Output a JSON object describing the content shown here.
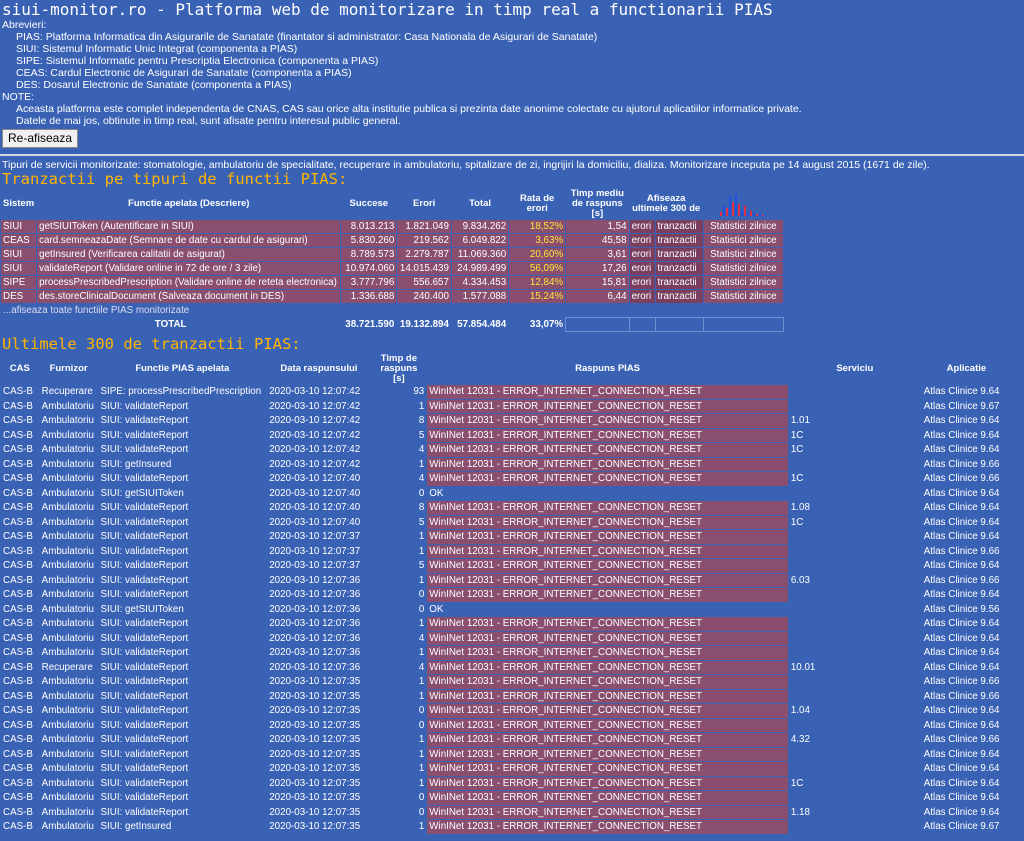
{
  "header": {
    "title": "siui-monitor.ro - Platforma web de monitorizare in timp real a functionarii PIAS",
    "abbr_label": "Abrevieri:",
    "abbr": [
      "PIAS: Platforma Informatica din Asigurarile de Sanatate (finantator si administrator: Casa Nationala de Asigurari de Sanatate)",
      "SIUI: Sistemul Informatic Unic Integrat (componenta a PIAS)",
      "SIPE: Sistemul Informatic pentru Prescriptia Electronica (componenta a PIAS)",
      "CEAS: Cardul Electronic de Asigurari de Sanatate (componenta a PIAS)",
      "DES: Dosarul Electronic de Sanatate (componenta a PIAS)"
    ],
    "note_label": "NOTE:",
    "notes": [
      "Aceasta platforma este complet independenta de CNAS, CAS sau orice alta institutie publica si prezinta date anonime colectate cu ajutorul aplicatiilor informatice private.",
      "Datele de mai jos, obtinute in timp real, sunt afisate pentru interesul public general."
    ],
    "refresh_button": "Re-afiseaza"
  },
  "intro": "Tipuri de servicii monitorizate: stomatologie, ambulatoriu de specialitate, recuperare in ambulatoriu, spitalizare de zi, ingrijiri la domiciliu, dializa. Monitorizare inceputa pe 14 august 2015 (1671 de zile).",
  "section1": {
    "title": "Tranzactii pe tipuri de functii PIAS:",
    "headers": [
      "Sistem",
      "Functie apelata (Descriere)",
      "Succese",
      "Erori",
      "Total",
      "Rata de erori",
      "Timp mediu de raspuns [s]",
      "Afiseaza ultimele 300 de"
    ],
    "rows": [
      {
        "sys": "SIUI",
        "fn": "getSIUIToken (Autentificare in SIUI)",
        "ok": "8.013.213",
        "err": "1.821.049",
        "tot": "9.834.262",
        "rate": "18,52%",
        "time": "1,54"
      },
      {
        "sys": "CEAS",
        "fn": "card.semneazaDate (Semnare de date cu cardul de asigurari)",
        "ok": "5.830.260",
        "err": "219.562",
        "tot": "6.049.822",
        "rate": "3,63%",
        "time": "45,58"
      },
      {
        "sys": "SIUI",
        "fn": "getInsured (Verificarea calitatii de asigurat)",
        "ok": "8.789.573",
        "err": "2.279.787",
        "tot": "11.069.360",
        "rate": "20,60%",
        "time": "3,61"
      },
      {
        "sys": "SIUI",
        "fn": "validateReport (Validare online in 72 de ore / 3 zile)",
        "ok": "10.974.060",
        "err": "14.015.439",
        "tot": "24.989.499",
        "rate": "56,09%",
        "time": "17,26"
      },
      {
        "sys": "SIPE",
        "fn": "processPrescribedPrescription (Validare online de reteta electronica)",
        "ok": "3.777.796",
        "err": "556.657",
        "tot": "4.334.453",
        "rate": "12,84%",
        "time": "15,81"
      },
      {
        "sys": "DES",
        "fn": "des.storeClinicalDocument (Salveaza document in DES)",
        "ok": "1.336.688",
        "err": "240.400",
        "tot": "1.577.088",
        "rate": "15,24%",
        "time": "6,44"
      }
    ],
    "link_erori": "erori",
    "link_tranzactii": "tranzactii",
    "link_stats": "Statistici zilnice",
    "more_link": "...afiseaza toate functiile PIAS monitorizate",
    "total": {
      "label": "TOTAL",
      "ok": "38.721.590",
      "err": "19.132.894",
      "tot": "57.854.484",
      "rate": "33,07%"
    }
  },
  "section2": {
    "title": "Ultimele 300 de tranzactii PIAS:",
    "headers": [
      "CAS",
      "Furnizor",
      "Functie PIAS apelata",
      "Data raspunsului",
      "Timp de raspuns [s]",
      "Raspuns PIAS",
      "Serviciu",
      "Aplicatie"
    ],
    "rows": [
      [
        "CAS-B",
        "Recuperare",
        "SIPE: processPrescribedPrescription",
        "2020-03-10 12:07:42",
        "93",
        "WinINet 12031 - ERROR_INTERNET_CONNECTION_RESET",
        "",
        "Atlas Clinice 9.64"
      ],
      [
        "CAS-B",
        "Ambulatoriu",
        "SIUI: validateReport",
        "2020-03-10 12:07:42",
        "1",
        "WinINet 12031 - ERROR_INTERNET_CONNECTION_RESET",
        "",
        "Atlas Clinice 9.67"
      ],
      [
        "CAS-B",
        "Ambulatoriu",
        "SIUI: validateReport",
        "2020-03-10 12:07:42",
        "8",
        "WinINet 12031 - ERROR_INTERNET_CONNECTION_RESET",
        "1.01",
        "Atlas Clinice 9.64"
      ],
      [
        "CAS-B",
        "Ambulatoriu",
        "SIUI: validateReport",
        "2020-03-10 12:07:42",
        "5",
        "WinINet 12031 - ERROR_INTERNET_CONNECTION_RESET",
        "1C",
        "Atlas Clinice 9.64"
      ],
      [
        "CAS-B",
        "Ambulatoriu",
        "SIUI: validateReport",
        "2020-03-10 12:07:42",
        "4",
        "WinINet 12031 - ERROR_INTERNET_CONNECTION_RESET",
        "1C",
        "Atlas Clinice 9.64"
      ],
      [
        "CAS-B",
        "Ambulatoriu",
        "SIUI: getInsured",
        "2020-03-10 12:07:42",
        "1",
        "WinINet 12031 - ERROR_INTERNET_CONNECTION_RESET",
        "",
        "Atlas Clinice 9.66"
      ],
      [
        "CAS-B",
        "Ambulatoriu",
        "SIUI: validateReport",
        "2020-03-10 12:07:40",
        "4",
        "WinINet 12031 - ERROR_INTERNET_CONNECTION_RESET",
        "1C",
        "Atlas Clinice 9.66"
      ],
      [
        "CAS-B",
        "Ambulatoriu",
        "SIUI: getSIUIToken",
        "2020-03-10 12:07:40",
        "0",
        "OK",
        "",
        "Atlas Clinice 9.64"
      ],
      [
        "CAS-B",
        "Ambulatoriu",
        "SIUI: validateReport",
        "2020-03-10 12:07:40",
        "8",
        "WinINet 12031 - ERROR_INTERNET_CONNECTION_RESET",
        "1.08",
        "Atlas Clinice 9.64"
      ],
      [
        "CAS-B",
        "Ambulatoriu",
        "SIUI: validateReport",
        "2020-03-10 12:07:40",
        "5",
        "WinINet 12031 - ERROR_INTERNET_CONNECTION_RESET",
        "1C",
        "Atlas Clinice 9.64"
      ],
      [
        "CAS-B",
        "Ambulatoriu",
        "SIUI: validateReport",
        "2020-03-10 12:07:37",
        "1",
        "WinINet 12031 - ERROR_INTERNET_CONNECTION_RESET",
        "",
        "Atlas Clinice 9.64"
      ],
      [
        "CAS-B",
        "Ambulatoriu",
        "SIUI: validateReport",
        "2020-03-10 12:07:37",
        "1",
        "WinINet 12031 - ERROR_INTERNET_CONNECTION_RESET",
        "",
        "Atlas Clinice 9.66"
      ],
      [
        "CAS-B",
        "Ambulatoriu",
        "SIUI: validateReport",
        "2020-03-10 12:07:37",
        "5",
        "WinINet 12031 - ERROR_INTERNET_CONNECTION_RESET",
        "",
        "Atlas Clinice 9.64"
      ],
      [
        "CAS-B",
        "Ambulatoriu",
        "SIUI: validateReport",
        "2020-03-10 12:07:36",
        "1",
        "WinINet 12031 - ERROR_INTERNET_CONNECTION_RESET",
        "6.03",
        "Atlas Clinice 9.66"
      ],
      [
        "CAS-B",
        "Ambulatoriu",
        "SIUI: validateReport",
        "2020-03-10 12:07:36",
        "0",
        "WinINet 12031 - ERROR_INTERNET_CONNECTION_RESET",
        "",
        "Atlas Clinice 9.64"
      ],
      [
        "CAS-B",
        "Ambulatoriu",
        "SIUI: getSIUIToken",
        "2020-03-10 12:07:36",
        "0",
        "OK",
        "",
        "Atlas Clinice 9.56"
      ],
      [
        "CAS-B",
        "Ambulatoriu",
        "SIUI: validateReport",
        "2020-03-10 12:07:36",
        "1",
        "WinINet 12031 - ERROR_INTERNET_CONNECTION_RESET",
        "",
        "Atlas Clinice 9.64"
      ],
      [
        "CAS-B",
        "Ambulatoriu",
        "SIUI: validateReport",
        "2020-03-10 12:07:36",
        "4",
        "WinINet 12031 - ERROR_INTERNET_CONNECTION_RESET",
        "",
        "Atlas Clinice 9.64"
      ],
      [
        "CAS-B",
        "Ambulatoriu",
        "SIUI: validateReport",
        "2020-03-10 12:07:36",
        "1",
        "WinINet 12031 - ERROR_INTERNET_CONNECTION_RESET",
        "",
        "Atlas Clinice 9.64"
      ],
      [
        "CAS-B",
        "Recuperare",
        "SIUI: validateReport",
        "2020-03-10 12:07:36",
        "4",
        "WinINet 12031 - ERROR_INTERNET_CONNECTION_RESET",
        "10.01",
        "Atlas Clinice 9.64"
      ],
      [
        "CAS-B",
        "Ambulatoriu",
        "SIUI: validateReport",
        "2020-03-10 12:07:35",
        "1",
        "WinINet 12031 - ERROR_INTERNET_CONNECTION_RESET",
        "",
        "Atlas Clinice 9.66"
      ],
      [
        "CAS-B",
        "Ambulatoriu",
        "SIUI: validateReport",
        "2020-03-10 12:07:35",
        "1",
        "WinINet 12031 - ERROR_INTERNET_CONNECTION_RESET",
        "",
        "Atlas Clinice 9.66"
      ],
      [
        "CAS-B",
        "Ambulatoriu",
        "SIUI: validateReport",
        "2020-03-10 12:07:35",
        "0",
        "WinINet 12031 - ERROR_INTERNET_CONNECTION_RESET",
        "1.04",
        "Atlas Clinice 9.64"
      ],
      [
        "CAS-B",
        "Ambulatoriu",
        "SIUI: validateReport",
        "2020-03-10 12:07:35",
        "0",
        "WinINet 12031 - ERROR_INTERNET_CONNECTION_RESET",
        "",
        "Atlas Clinice 9.64"
      ],
      [
        "CAS-B",
        "Ambulatoriu",
        "SIUI: validateReport",
        "2020-03-10 12:07:35",
        "1",
        "WinINet 12031 - ERROR_INTERNET_CONNECTION_RESET",
        "4.32",
        "Atlas Clinice 9.66"
      ],
      [
        "CAS-B",
        "Ambulatoriu",
        "SIUI: validateReport",
        "2020-03-10 12:07:35",
        "1",
        "WinINet 12031 - ERROR_INTERNET_CONNECTION_RESET",
        "",
        "Atlas Clinice 9.64"
      ],
      [
        "CAS-B",
        "Ambulatoriu",
        "SIUI: validateReport",
        "2020-03-10 12:07:35",
        "1",
        "WinINet 12031 - ERROR_INTERNET_CONNECTION_RESET",
        "",
        "Atlas Clinice 9.64"
      ],
      [
        "CAS-B",
        "Ambulatoriu",
        "SIUI: validateReport",
        "2020-03-10 12:07:35",
        "1",
        "WinINet 12031 - ERROR_INTERNET_CONNECTION_RESET",
        "1C",
        "Atlas Clinice 9.64"
      ],
      [
        "CAS-B",
        "Ambulatoriu",
        "SIUI: validateReport",
        "2020-03-10 12:07:35",
        "0",
        "WinINet 12031 - ERROR_INTERNET_CONNECTION_RESET",
        "",
        "Atlas Clinice 9.64"
      ],
      [
        "CAS-B",
        "Ambulatoriu",
        "SIUI: validateReport",
        "2020-03-10 12:07:35",
        "0",
        "WinINet 12031 - ERROR_INTERNET_CONNECTION_RESET",
        "1.18",
        "Atlas Clinice 9.64"
      ],
      [
        "CAS-B",
        "Ambulatoriu",
        "SIUI: getInsured",
        "2020-03-10 12:07:35",
        "1",
        "WinINet 12031 - ERROR_INTERNET_CONNECTION_RESET",
        "",
        "Atlas Clinice 9.67"
      ]
    ]
  },
  "colors": {
    "bg": "#3a62b4",
    "error_row": "#8a4e6e",
    "heading": "#ffb400",
    "rate": "#ffe53a"
  }
}
